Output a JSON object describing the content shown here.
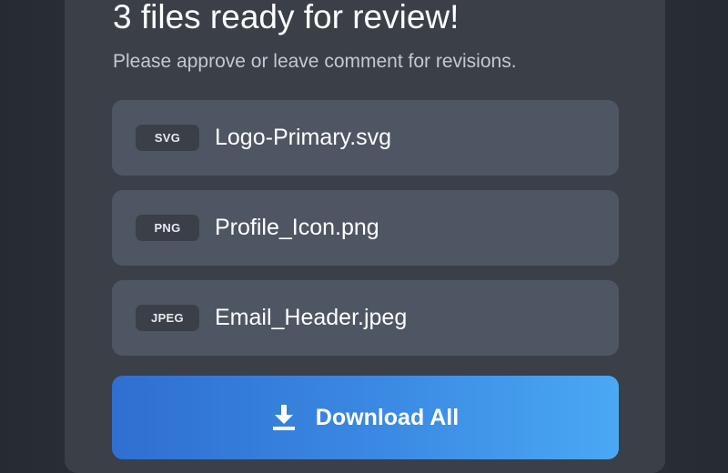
{
  "header": {
    "title": "3 files ready for review!",
    "subtitle": "Please approve or leave comment for revisions."
  },
  "files": [
    {
      "type": "SVG",
      "name": "Logo-Primary.svg"
    },
    {
      "type": "PNG",
      "name": "Profile_Icon.png"
    },
    {
      "type": "JPEG",
      "name": "Email_Header.jpeg"
    }
  ],
  "actions": {
    "download_label": "Download All",
    "download_icon": "download-icon"
  },
  "colors": {
    "background": "#2f343c",
    "card": "#3a3f48",
    "file_row": "#4f5663",
    "button_gradient_start": "#2f6fd0",
    "button_gradient_end": "#4aa8f4"
  }
}
